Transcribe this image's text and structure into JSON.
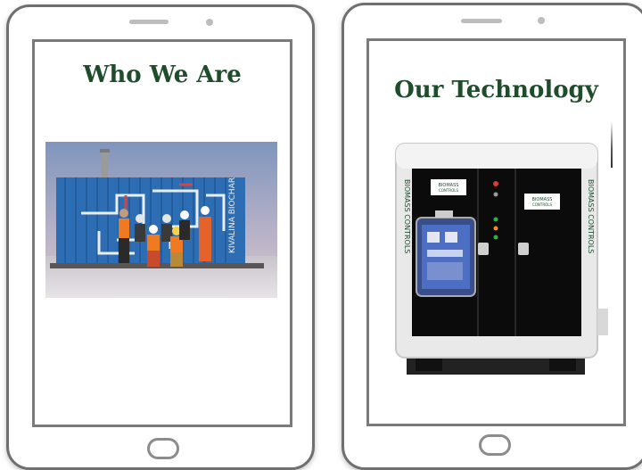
{
  "panels": {
    "left": {
      "title": "Who We Are",
      "container_text": "KIVALINA BIOCHAR"
    },
    "right": {
      "title": "Our Technology",
      "brand_top": "BIOMASS",
      "brand_bottom": "CONTROLS",
      "side_label": "BIOMASS CONTROLS"
    }
  },
  "colors": {
    "title_green": "#1f4d2c",
    "container_blue": "#2c6db3",
    "frame_gray": "#6f6f6f"
  },
  "icons": [
    "speaker-grille",
    "front-camera",
    "home-button"
  ]
}
